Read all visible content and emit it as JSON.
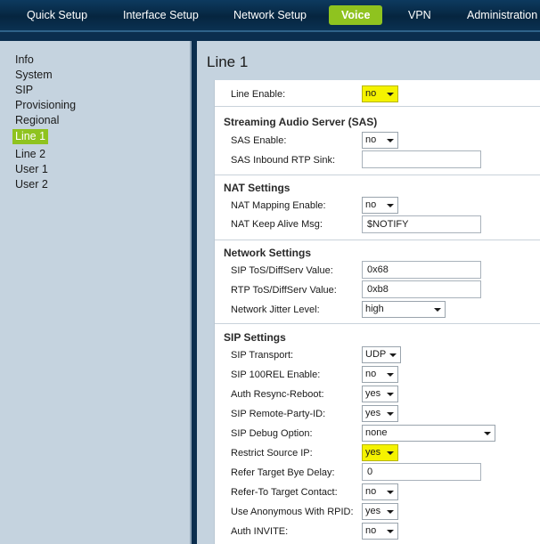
{
  "nav": {
    "tabs": [
      {
        "label": "Quick Setup"
      },
      {
        "label": "Interface Setup"
      },
      {
        "label": "Network Setup"
      },
      {
        "label": "Voice"
      },
      {
        "label": "VPN"
      },
      {
        "label": "Administration"
      }
    ],
    "active_tab": "Voice",
    "accent_color": "#8fc31f"
  },
  "sidebar": {
    "items": [
      {
        "label": "Info"
      },
      {
        "label": "System"
      },
      {
        "label": "SIP"
      },
      {
        "label": "Provisioning"
      },
      {
        "label": "Regional"
      },
      {
        "label": "Line 1"
      },
      {
        "label": "Line 2"
      },
      {
        "label": "User 1"
      },
      {
        "label": "User 2"
      }
    ],
    "active_item": "Line 1"
  },
  "page": {
    "title": "Line 1"
  },
  "form": {
    "line_enable": {
      "label": "Line Enable:",
      "value": "no"
    },
    "sas": {
      "title": "Streaming Audio Server (SAS)",
      "enable": {
        "label": "SAS Enable:",
        "value": "no"
      },
      "rtp_sink": {
        "label": "SAS Inbound RTP Sink:",
        "value": ""
      }
    },
    "nat": {
      "title": "NAT Settings",
      "mapping": {
        "label": "NAT Mapping Enable:",
        "value": "no"
      },
      "keep_alive": {
        "label": "NAT Keep Alive Msg:",
        "value": "$NOTIFY"
      }
    },
    "network": {
      "title": "Network Settings",
      "sip_tos": {
        "label": "SIP ToS/DiffServ Value:",
        "value": "0x68"
      },
      "rtp_tos": {
        "label": "RTP ToS/DiffServ Value:",
        "value": "0xb8"
      },
      "jitter": {
        "label": "Network Jitter Level:",
        "value": "high"
      }
    },
    "sip": {
      "title": "SIP Settings",
      "transport": {
        "label": "SIP Transport:",
        "value": "UDP"
      },
      "rel100": {
        "label": "SIP 100REL Enable:",
        "value": "no"
      },
      "resync": {
        "label": "Auth Resync-Reboot:",
        "value": "yes"
      },
      "remote_party": {
        "label": "SIP Remote-Party-ID:",
        "value": "yes"
      },
      "debug": {
        "label": "SIP Debug Option:",
        "value": "none"
      },
      "restrict_ip": {
        "label": "Restrict Source IP:",
        "value": "yes"
      },
      "refer_delay": {
        "label": "Refer Target Bye Delay:",
        "value": "0"
      },
      "refer_contact": {
        "label": "Refer-To Target Contact:",
        "value": "no"
      },
      "anon_rpid": {
        "label": "Use Anonymous With RPID:",
        "value": "yes"
      },
      "auth_invite": {
        "label": "Auth INVITE:",
        "value": "no"
      }
    }
  },
  "colors": {
    "highlight": "#f5f300",
    "nav_bg": "#0b2e4e",
    "panel_bg": "#c5d3df"
  }
}
